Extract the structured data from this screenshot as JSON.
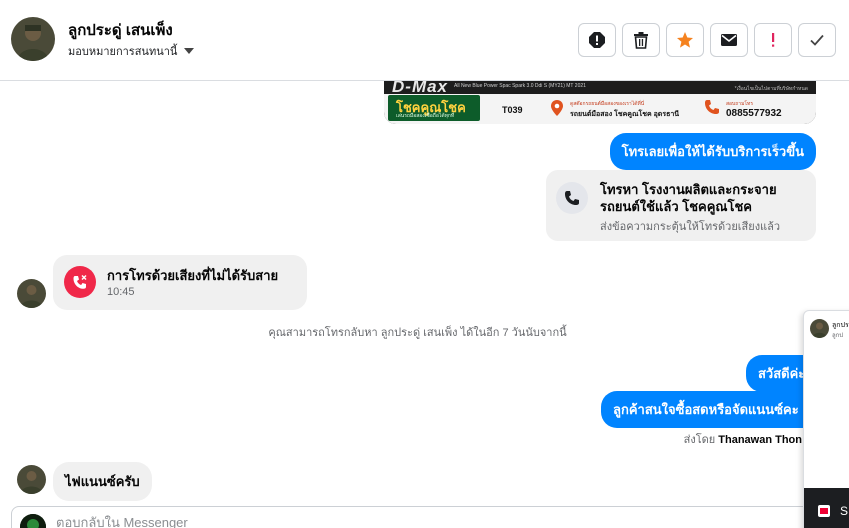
{
  "header": {
    "contact_name": "ลูกประดู่ เสนเพ็ง",
    "assign_label": "มอบหมายการสนทนานี้"
  },
  "actions": [
    {
      "name": "mark-spam-button",
      "icon": "alert-octagon-icon"
    },
    {
      "name": "delete-button",
      "icon": "trash-icon"
    },
    {
      "name": "star-button",
      "icon": "star-icon",
      "color": "#f5821f"
    },
    {
      "name": "mark-unread-button",
      "icon": "envelope-icon"
    },
    {
      "name": "follow-up-button",
      "icon": "exclamation-icon",
      "color": "#e0245e"
    },
    {
      "name": "mark-done-button",
      "icon": "check-icon"
    }
  ],
  "banner": {
    "brand": "D-Max",
    "tagline": "All New Blue Power Spac Spark 3.0 Ddi S (MY21) MT 2021",
    "note": "*เงื่อนไขเป็นไปตามที่บริษัทกำหนด",
    "logo": "โชคคูณโชค",
    "logo_sub": "เล่นรถมือสองเชื่อถือได้ทุกที่",
    "code": "T039",
    "addr_label": "ดูสต๊อกรถยนต์มือสองของเราได้ที่นี่",
    "addr": "รถยนต์มือสอง โชคคูณโชค อุดรธานี",
    "phone_label": "สอบถามโทร",
    "phone": "0885577932"
  },
  "messages": {
    "out_call_prompt": "โทรเลยเพื่อให้ได้รับบริการเร็วขึ้น",
    "call_card_title": "โทรหา โรงงานผลิตและกระจายรถยนต์ใช้แล้ว โชคคูณโชค",
    "call_card_sub": "ส่งข้อความกระตุ้นให้โทรด้วยเสียงแล้ว",
    "missed_title": "การโทรด้วยเสียงที่ไม่ได้รับสาย",
    "missed_time": "10:45",
    "notice": "คุณสามารถโทรกลับหา ลูกประดู่ เสนเพ็ง ได้ในอีก 7 วันนับจากนี้",
    "out_greeting": "สวัสดีค่ะ",
    "out_question": "ลูกค้าสนใจซื้อสดหรือจัดแนนซ์คะ",
    "sent_by_label": "ส่งโดย",
    "sent_by_name": "Thanawan Thon",
    "in_reply": "ไฟแนนซ์ครับ"
  },
  "composer": {
    "placeholder": "ตอบกลับใน Messenger"
  },
  "popup": {
    "name": "ลูกประ",
    "name2": "ลูกป",
    "letter": "S"
  }
}
